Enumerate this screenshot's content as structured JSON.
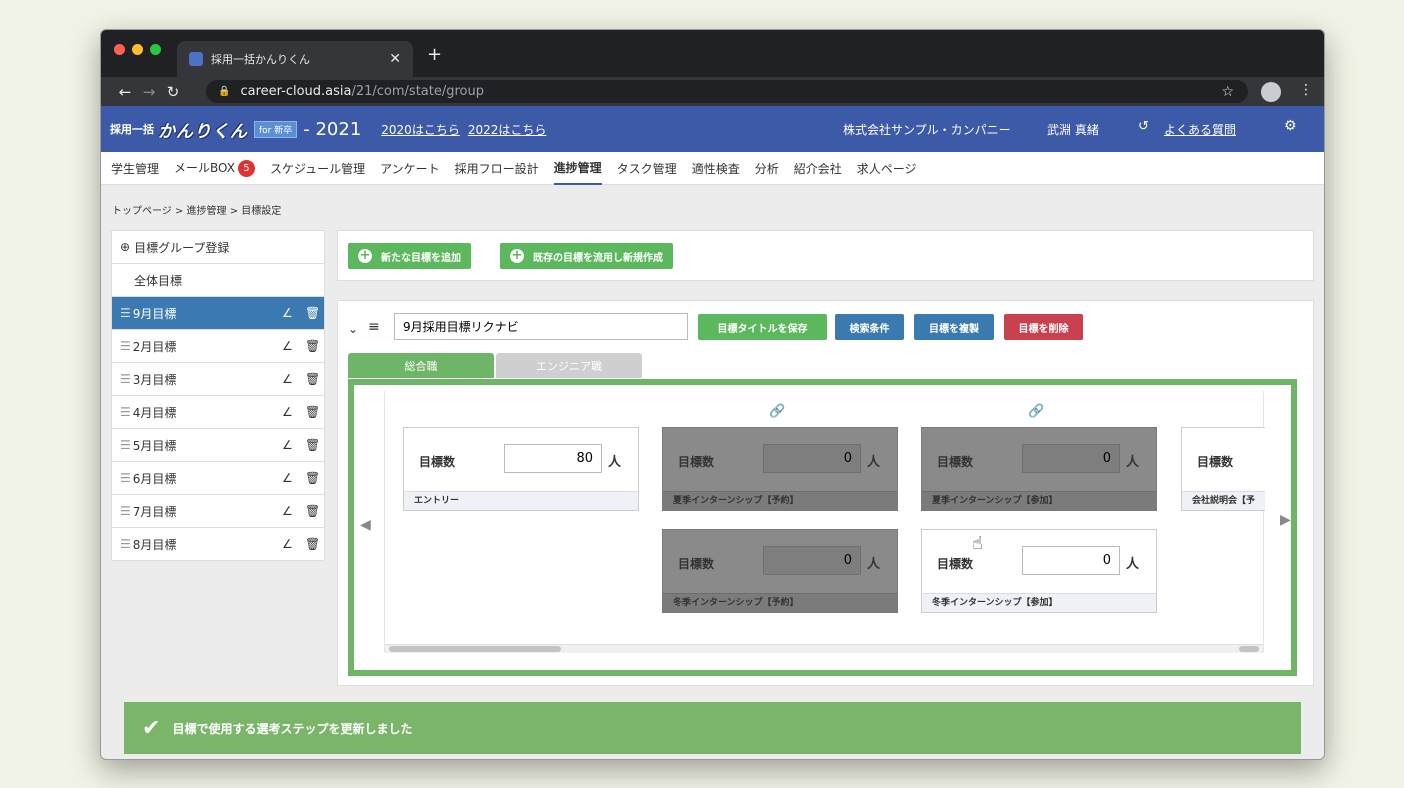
{
  "browser": {
    "tab_title": "採用一括かんりくん",
    "url_host": "career-cloud.asia",
    "url_path": "/21/com/state/group",
    "colors": {
      "light_red": "#ff5f57",
      "light_yellow": "#febc2e",
      "light_green": "#28c840"
    }
  },
  "header": {
    "brand_prefix": "採用一括",
    "brand_logo": "かんりくん",
    "brand_badge": "for 新卒",
    "year": "- 2021",
    "link_2020": "2020はこちら",
    "link_2022": "2022はこちら",
    "company": "株式会社サンプル・カンパニー",
    "user": "武淵 真緒",
    "help": "よくある質問",
    "color": "#3c5aa8"
  },
  "menu": {
    "items": [
      {
        "label": "学生管理"
      },
      {
        "label": "メールBOX",
        "badge": "5"
      },
      {
        "label": "スケジュール管理"
      },
      {
        "label": "アンケート"
      },
      {
        "label": "採用フロー設計"
      },
      {
        "label": "進捗管理",
        "active": true
      },
      {
        "label": "タスク管理"
      },
      {
        "label": "適性検査"
      },
      {
        "label": "分析"
      },
      {
        "label": "紹介会社"
      },
      {
        "label": "求人ページ"
      }
    ]
  },
  "breadcrumb": "トップページ > 進捗管理 > 目標設定",
  "sidebar": {
    "register": "目標グループ登録",
    "all": "全体目標",
    "items": [
      {
        "label": "9月目標",
        "selected": true
      },
      {
        "label": "2月目標"
      },
      {
        "label": "3月目標"
      },
      {
        "label": "4月目標"
      },
      {
        "label": "5月目標"
      },
      {
        "label": "6月目標"
      },
      {
        "label": "7月目標"
      },
      {
        "label": "8月目標"
      }
    ]
  },
  "actions": {
    "add_new": "新たな目標を追加",
    "reuse": "既存の目標を流用し新規作成"
  },
  "panel": {
    "title_value": "9月採用目標リクナビ",
    "save_title": "目標タイトルを保存",
    "search": "検索条件",
    "duplicate": "目標を複製",
    "delete": "目標を削除",
    "subtabs": [
      "総合職",
      "エンジニア職"
    ],
    "cards": [
      {
        "label": "目標数",
        "value": "80",
        "unit": "人",
        "foot": "エントリー",
        "dark": false
      },
      {
        "label": "目標数",
        "value": "0",
        "unit": "人",
        "foot": "夏季インターンシップ【予約】",
        "dark": true
      },
      {
        "label": "目標数",
        "value": "0",
        "unit": "人",
        "foot": "夏季インターンシップ【参加】",
        "dark": true
      },
      {
        "label": "目標数",
        "value": "",
        "unit": "",
        "foot": "会社説明会【予",
        "dark": false
      },
      {
        "label": "目標数",
        "value": "0",
        "unit": "人",
        "foot": "冬季インターンシップ【予約】",
        "dark": true
      },
      {
        "label": "目標数",
        "value": "0",
        "unit": "人",
        "foot": "冬季インターンシップ【参加】",
        "dark": false
      }
    ]
  },
  "toast": "目標で使用する選考ステップを更新しました"
}
